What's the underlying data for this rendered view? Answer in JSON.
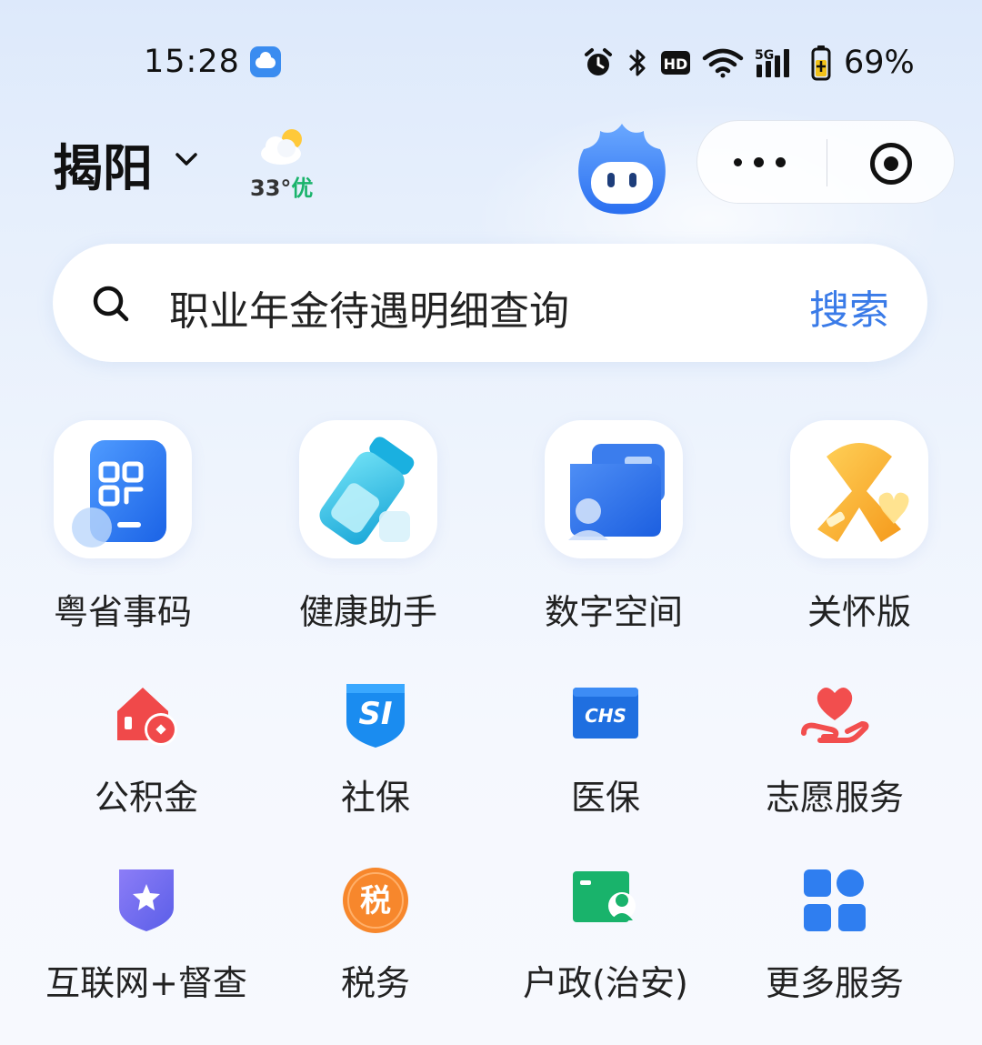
{
  "status_bar": {
    "time": "15:28",
    "battery_percent": "69%",
    "network_label": "5G",
    "hd_label": "HD"
  },
  "header": {
    "city": "揭阳",
    "weather_temp": "33°",
    "weather_quality": "优"
  },
  "search": {
    "query": "职业年金待遇明细查询",
    "button_label": "搜索"
  },
  "featured": [
    {
      "label": "粤省事码",
      "icon": "qr-code-card-icon"
    },
    {
      "label": "健康助手",
      "icon": "health-thermos-icon"
    },
    {
      "label": "数字空间",
      "icon": "wallet-folder-icon"
    },
    {
      "label": "关怀版",
      "icon": "care-ribbon-icon"
    }
  ],
  "services_row1": [
    {
      "label": "公积金",
      "icon": "housing-fund-icon"
    },
    {
      "label": "社保",
      "icon": "social-security-icon"
    },
    {
      "label": "医保",
      "icon": "medical-insurance-icon"
    },
    {
      "label": "志愿服务",
      "icon": "volunteer-heart-icon"
    }
  ],
  "services_row2": [
    {
      "label": "互联网+督查",
      "icon": "supervision-shield-icon"
    },
    {
      "label": "税务",
      "icon": "tax-icon"
    },
    {
      "label": "户政(治安)",
      "icon": "household-registration-icon"
    },
    {
      "label": "更多服务",
      "icon": "more-services-grid-icon"
    }
  ],
  "icon_text": {
    "si": "SI",
    "chs": "CHS",
    "tax": "税"
  },
  "colors": {
    "accent_blue": "#3a7be8",
    "air_quality_green": "#19b36b",
    "housing_fund_red": "#f0494a",
    "social_security_blue": "#1a8cf0",
    "medical_blue": "#1f6fe0",
    "volunteer_red": "#f24e4e",
    "supervision_purple": "#6a68f0",
    "tax_orange": "#f7872c",
    "household_green": "#19b36b",
    "more_blue": "#2f7ef0"
  }
}
